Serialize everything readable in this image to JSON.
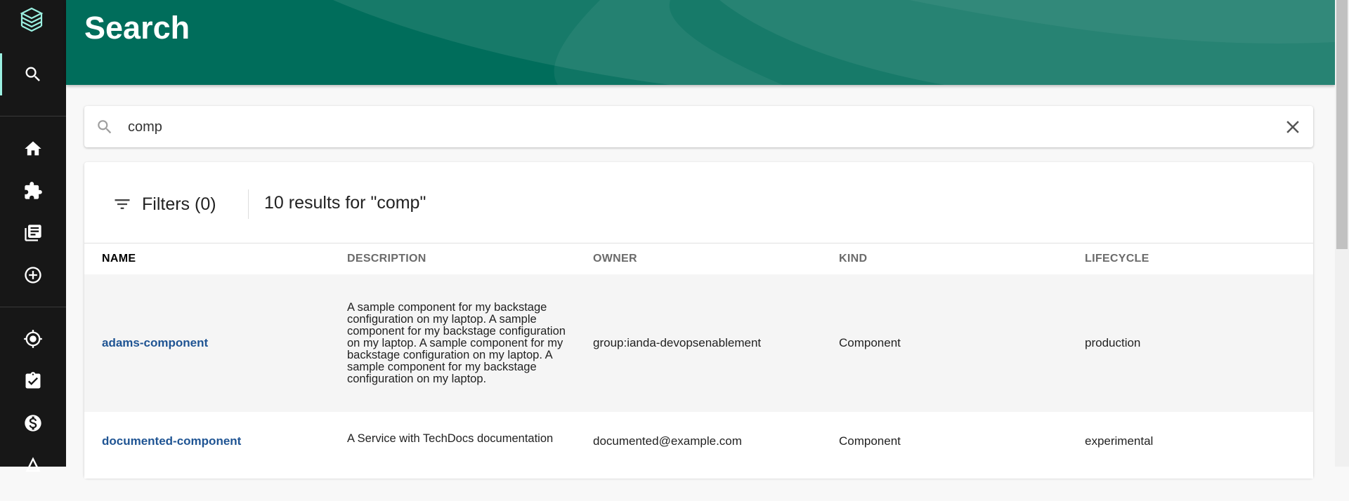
{
  "header": {
    "title": "Search"
  },
  "sidebar": {
    "logo_icon": "backstage-logo-icon",
    "items": [
      {
        "icon": "search-icon",
        "active": true
      },
      {
        "icon": "home-icon"
      },
      {
        "icon": "puzzle-icon"
      },
      {
        "icon": "library-icon"
      },
      {
        "icon": "add-circle-icon"
      },
      {
        "icon": "target-icon"
      },
      {
        "icon": "assignment-check-icon"
      },
      {
        "icon": "money-icon"
      },
      {
        "icon": "graph-icon"
      }
    ]
  },
  "search": {
    "value": "comp",
    "placeholder": ""
  },
  "results": {
    "filters_label": "Filters (0)",
    "count_text": "10 results for \"comp\"",
    "columns": [
      "NAME",
      "DESCRIPTION",
      "OWNER",
      "KIND",
      "LIFECYCLE"
    ],
    "rows": [
      {
        "name": "adams-component",
        "description": "A sample component for my backstage configuration on my laptop. A sample component for my backstage configuration on my laptop. A sample component for my backstage configuration on my laptop. A sample component for my backstage configuration on my laptop.",
        "owner": "group:ianda-devopsenablement",
        "kind": "Component",
        "lifecycle": "production"
      },
      {
        "name": "documented-component",
        "description": "A Service with TechDocs documentation",
        "owner": "documented@example.com",
        "kind": "Component",
        "lifecycle": "experimental"
      }
    ]
  },
  "colors": {
    "header": "#006d5b",
    "sidebar": "#171717",
    "link": "#1f5493",
    "active_indicator": "#9bf0e1"
  }
}
